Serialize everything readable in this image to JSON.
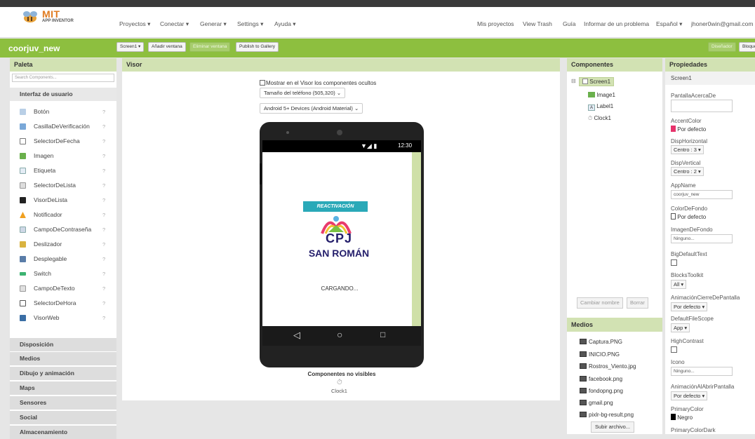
{
  "topnav": {
    "logo_mit": "MIT",
    "logo_sub": "APP INVENTOR",
    "menu": [
      "Proyectos ▾",
      "Conectar ▾",
      "Generar ▾",
      "Settings ▾",
      "Ayuda ▾"
    ],
    "right": [
      "Mis proyectos",
      "View Trash",
      "Guía",
      "Informar de un problema",
      "Español ▾",
      "jhoner0win@gmail.com"
    ]
  },
  "project": {
    "name": "coorjuv_new",
    "screen_button": "Screen1 ▾",
    "add_screen": "Añadir ventana",
    "remove_screen": "Eliminar ventana",
    "publish": "Publish to Gallery",
    "designer": "Diseñador",
    "blocks": "Bloques"
  },
  "palette": {
    "title": "Paleta",
    "search_placeholder": "Search Components...",
    "section": "Interfaz de usuario",
    "items": [
      "Botón",
      "CasillaDeVerificación",
      "SelectorDeFecha",
      "Imagen",
      "Etiqueta",
      "SelectorDeLista",
      "VisorDeLista",
      "Notificador",
      "CampoDeContraseña",
      "Deslizador",
      "Desplegable",
      "Switch",
      "CampoDeTexto",
      "SelectorDeHora",
      "VisorWeb"
    ],
    "help": "?",
    "categories": [
      "Disposición",
      "Medios",
      "Dibujo y animación",
      "Maps",
      "Sensores",
      "Social",
      "Almacenamiento"
    ]
  },
  "visor": {
    "title": "Visor",
    "show_hidden": "Mostrar en el Visor los componentes ocultos",
    "size_select": "Tamaño del teléfono (505,320)",
    "theme_select": "Android 5+ Devices (Android Material)",
    "clock_time": "12:30",
    "banner": "REACTIVACIÓN",
    "logo_text": "CPJ",
    "logo_sub": "SAN ROMÁN",
    "loading": "CARGANDO...",
    "nonvisible_title": "Componentes no visibles",
    "nonvisible_item": "Clock1"
  },
  "components": {
    "title": "Componentes",
    "root": "Screen1",
    "children": [
      "Image1",
      "Label1",
      "Clock1"
    ],
    "rename": "Cambiar nombre",
    "delete": "Borrar"
  },
  "media": {
    "title": "Medios",
    "files": [
      "Captura.PNG",
      "INICIO.PNG",
      "Rostros_Viento.jpg",
      "facebook.png",
      "fondopng.png",
      "gmail.png",
      "pixlr-bg-result.png"
    ],
    "upload": "Subir archivo..."
  },
  "properties": {
    "title": "Propiedades",
    "screen": "Screen1",
    "about_label": "PantallaAcercaDe",
    "accent_label": "AccentColor",
    "accent_value": "Por defecto",
    "halign_label": "DispHorizontal",
    "halign_value": "Centro : 3 ▾",
    "valign_label": "DispVertical",
    "valign_value": "Centro : 2 ▾",
    "appname_label": "AppName",
    "appname_value": "coorjuv_new",
    "bg_label": "ColorDeFondo",
    "bg_value": "Por defecto",
    "bgimg_label": "ImagenDeFondo",
    "bgimg_value": "Ninguno...",
    "bigtext_label": "BigDefaultText",
    "toolkit_label": "BlocksToolkit",
    "toolkit_value": "All ▾",
    "close_anim_label": "AnimaciónCierreDePantalla",
    "close_anim_value": "Por defecto ▾",
    "filescope_label": "DefaultFileScope",
    "filescope_value": "App ▾",
    "contrast_label": "HighContrast",
    "icon_label": "Icono",
    "icon_value": "Ninguno...",
    "open_anim_label": "AnimaciónAlAbrirPantalla",
    "open_anim_value": "Por defecto ▾",
    "primary_label": "PrimaryColor",
    "primary_value": "Negro",
    "primary_dark_label": "PrimaryColorDark"
  },
  "colors": {
    "accent": "#8dbf3f",
    "panel_header": "#d2e2b3",
    "accent_swatch": "#e6336b"
  }
}
